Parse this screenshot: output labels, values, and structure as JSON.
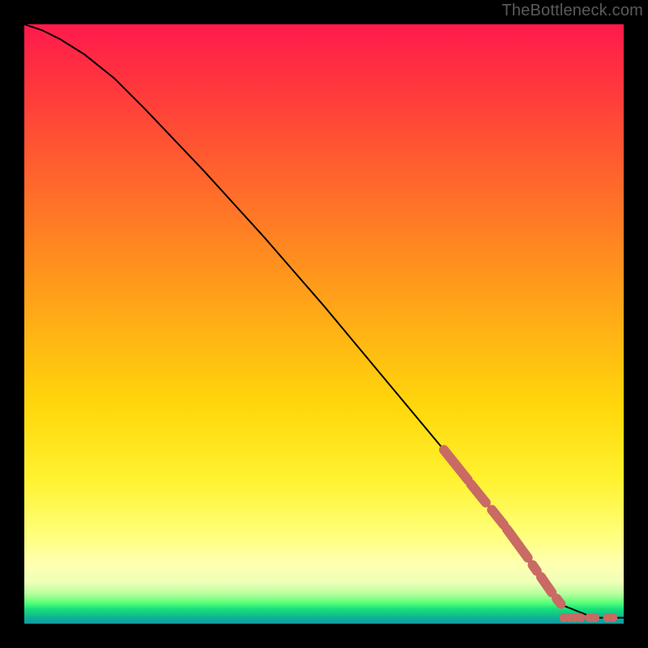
{
  "watermark": "TheBottleneck.com",
  "chart_data": {
    "type": "line",
    "title": "",
    "xlabel": "",
    "ylabel": "",
    "xlim": [
      0,
      100
    ],
    "ylim": [
      0,
      100
    ],
    "grid": false,
    "legend": false,
    "series": [
      {
        "name": "curve",
        "style": "line",
        "color": "#000000",
        "x": [
          0,
          3,
          6,
          10,
          15,
          20,
          30,
          40,
          50,
          60,
          70,
          75,
          80,
          82,
          85,
          90,
          95,
          100
        ],
        "y": [
          100,
          99,
          97.5,
          95,
          91,
          86,
          75.5,
          64.5,
          53,
          41,
          29,
          23,
          16.5,
          13.5,
          9,
          3,
          1,
          1
        ]
      },
      {
        "name": "highlight-segments",
        "style": "thick-overlay",
        "color": "#c96a64",
        "segments": [
          {
            "x0": 70,
            "y0": 29,
            "x1": 74,
            "y1": 24
          },
          {
            "x0": 74.5,
            "y0": 23.3,
            "x1": 77,
            "y1": 20.2
          },
          {
            "x0": 78,
            "y0": 19,
            "x1": 80,
            "y1": 16.5
          },
          {
            "x0": 80.5,
            "y0": 15.8,
            "x1": 84,
            "y1": 11
          },
          {
            "x0": 84.8,
            "y0": 9.8,
            "x1": 85.5,
            "y1": 8.8
          },
          {
            "x0": 86.2,
            "y0": 7.8,
            "x1": 88,
            "y1": 5.2
          },
          {
            "x0": 88.8,
            "y0": 4.2,
            "x1": 89.5,
            "y1": 3.3
          }
        ]
      },
      {
        "name": "bottom-dots",
        "style": "scatter",
        "color": "#c96a64",
        "x": [
          90,
          91,
          92,
          92.8,
          94.3,
          95.2,
          97.3,
          98.2
        ],
        "y": [
          1,
          1,
          1,
          1,
          1,
          1,
          1,
          1
        ]
      }
    ]
  }
}
